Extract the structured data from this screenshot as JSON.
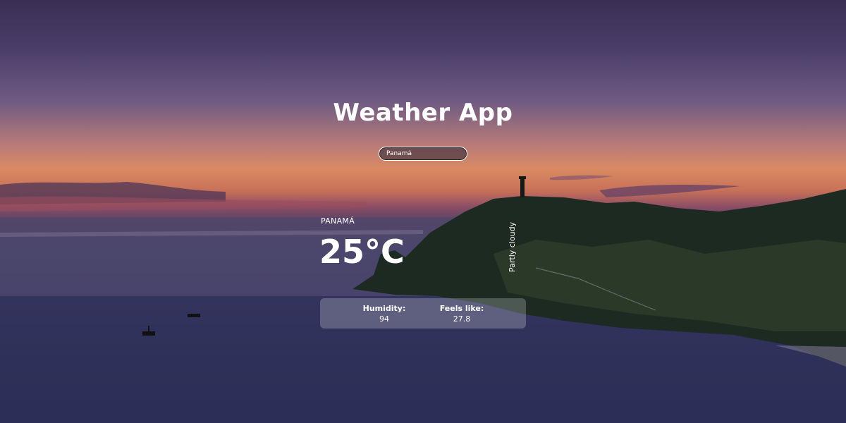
{
  "app": {
    "title": "Weather App"
  },
  "search": {
    "value": "Panamá"
  },
  "weather": {
    "city": "PANAMÁ",
    "temperature": "25°C",
    "description": "Partly cloudy"
  },
  "details": {
    "humidity_label": "Humidity:",
    "humidity_value": "94",
    "feels_like_label": "Feels like:",
    "feels_like_value": "27.8"
  },
  "colors": {
    "text": "#ffffff",
    "sky_top": "#3a2e54",
    "horizon": "#d98a62",
    "sea": "#2e2e55"
  }
}
